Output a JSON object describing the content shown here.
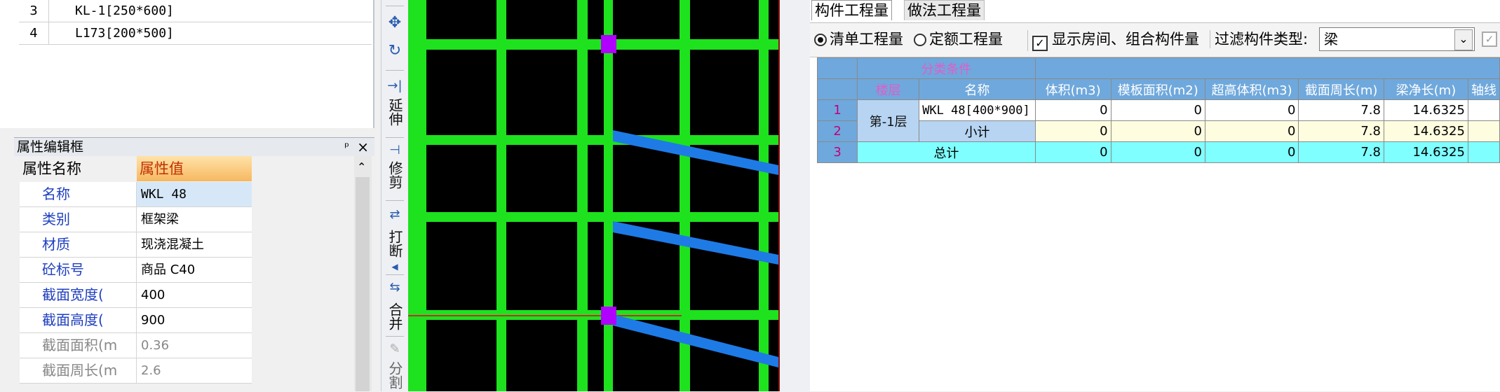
{
  "component_list": {
    "rows": [
      {
        "num": "3",
        "name": "KL-1[250*600]"
      },
      {
        "num": "4",
        "name": "L173[200*500]"
      }
    ]
  },
  "property_editor": {
    "title": "属性编辑框",
    "pin": "ᵖ",
    "close": "×",
    "col_name": "属性名称",
    "col_value": "属性值",
    "rows": [
      {
        "name": "名称",
        "value": "WKL 48"
      },
      {
        "name": "类别",
        "value": "框架梁"
      },
      {
        "name": "材质",
        "value": "现浇混凝土"
      },
      {
        "name": "砼标号",
        "value": "商品 C40"
      },
      {
        "name": "截面宽度(",
        "value": "400"
      },
      {
        "name": "截面高度(",
        "value": "900"
      },
      {
        "name": "截面面积(m",
        "value": "0.36"
      },
      {
        "name": "截面周长(m",
        "value": "2.6"
      }
    ]
  },
  "toolbar": {
    "extend": "延伸",
    "trim": "修剪",
    "break": "打断",
    "merge": "合并",
    "split": "分割"
  },
  "quantity_panel": {
    "tabs": [
      "构件工程量",
      "做法工程量"
    ],
    "radio_list": "清单工程量",
    "radio_quota": "定额工程量",
    "checkbox_show": "显示房间、组合构件量",
    "filter_label": "过滤构件类型:",
    "filter_value": "梁",
    "table": {
      "group_header": "分类条件",
      "headers": [
        "楼层",
        "名称",
        "体积(m3)",
        "模板面积(m2)",
        "超高体积(m3)",
        "截面周长(m)",
        "梁净长(m)",
        "轴线"
      ],
      "rows": [
        {
          "no": "1",
          "floor": "第-1层",
          "name": "WKL 48[400*900]",
          "vals": [
            "0",
            "0",
            "0",
            "7.8",
            "14.6325"
          ]
        },
        {
          "no": "2",
          "name": "小计",
          "vals": [
            "0",
            "0",
            "0",
            "7.8",
            "14.6325"
          ]
        },
        {
          "no": "3",
          "name": "总计",
          "vals": [
            "0",
            "0",
            "0",
            "7.8",
            "14.6325"
          ]
        }
      ]
    }
  },
  "colors": {
    "grid": "#1ee21e",
    "beam": "#1e7be6",
    "node": "#b000ff",
    "canvas": "#000000"
  }
}
